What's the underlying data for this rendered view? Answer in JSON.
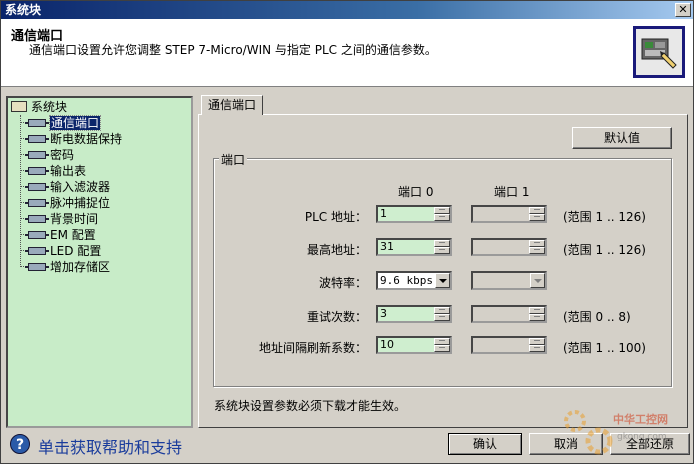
{
  "window": {
    "title": "系统块"
  },
  "header": {
    "title": "通信端口",
    "description": "通信端口设置允许您调整 STEP 7-Micro/WIN 与指定 PLC 之间的通信参数。"
  },
  "tree": {
    "root": "系统块",
    "items": [
      "通信端口",
      "断电数据保持",
      "密码",
      "输出表",
      "输入滤波器",
      "脉冲捕捉位",
      "背景时间",
      "EM 配置",
      "LED 配置",
      "增加存储区"
    ],
    "selected_index": 0
  },
  "tab": {
    "label": "通信端口"
  },
  "default_button": "默认值",
  "group": {
    "title": "端口",
    "col0": "端口 0",
    "col1": "端口 1",
    "rows": [
      {
        "label": "PLC 地址：",
        "port0": "1",
        "range": "(范围 1 .. 126)"
      },
      {
        "label": "最高地址：",
        "port0": "31",
        "range": "(范围 1 .. 126)"
      },
      {
        "label": "波特率：",
        "port0": "9.6 kbps",
        "range": ""
      },
      {
        "label": "重试次数：",
        "port0": "3",
        "range": "(范围 0 .. 8)"
      },
      {
        "label": "地址间隔刷新系数：",
        "port0": "10",
        "range": "(范围 1 .. 100)"
      }
    ]
  },
  "note": "系统块设置参数必须下载才能生效。",
  "footer": {
    "help_link": "单击获取帮助和支持",
    "ok": "确认",
    "cancel": "取消",
    "restore": "全部还原"
  },
  "watermark": {
    "text1": "中华工控网",
    "text2": "gkong.com"
  }
}
